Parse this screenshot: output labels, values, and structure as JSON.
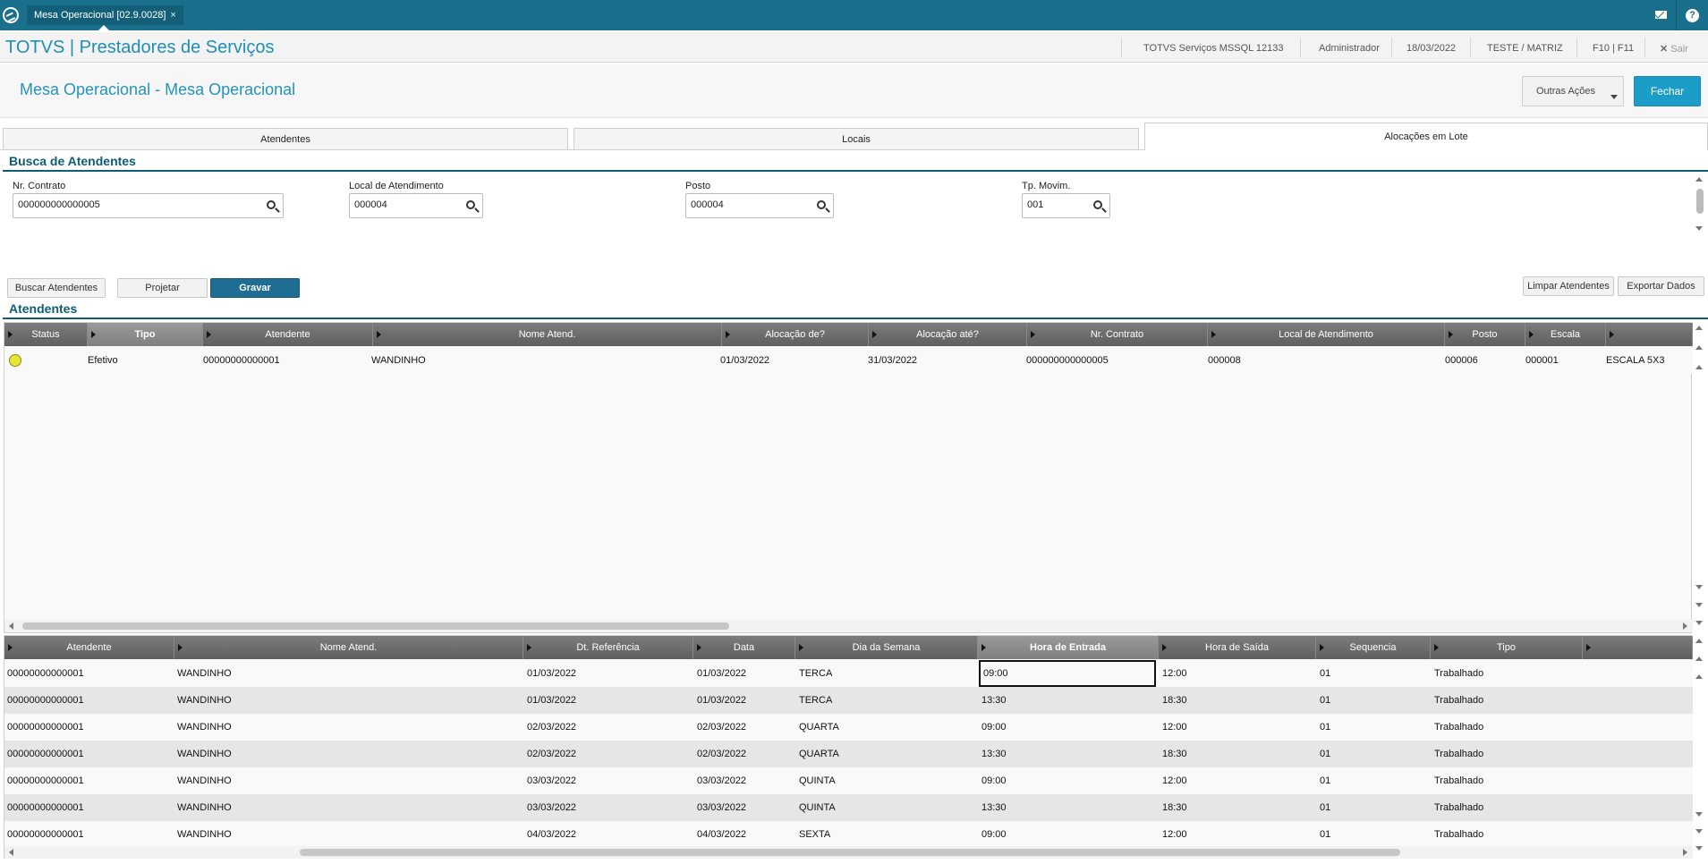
{
  "topbar": {
    "tab_label": "Mesa Operacional [02.9.0028]",
    "tab_close": "×",
    "help": "?"
  },
  "header": {
    "app_title": "TOTVS | Prestadores de Serviços",
    "environment": "TOTVS Serviços MSSQL 12133",
    "user": "Administrador",
    "date": "18/03/2022",
    "company": "TESTE / MATRIZ",
    "shortcuts": "F10 | F11",
    "exit_label": "Sair"
  },
  "page": {
    "title": "Mesa Operacional - Mesa Operacional",
    "btn_other": "Outras Ações",
    "btn_close": "Fechar"
  },
  "tabs": [
    {
      "label": "Atendentes"
    },
    {
      "label": "Locais"
    },
    {
      "label": "Alocações em Lote"
    }
  ],
  "search": {
    "section_title": "Busca de Atendentes",
    "fields": [
      {
        "label": "Nr. Contrato",
        "value": "000000000000005"
      },
      {
        "label": "Local de Atendimento",
        "value": "000004"
      },
      {
        "label": "Posto",
        "value": "000004"
      },
      {
        "label": "Tp. Movim.",
        "value": "001"
      }
    ],
    "btn_search": "Buscar Atendentes",
    "btn_project": "Projetar",
    "btn_save": "Gravar",
    "btn_clear": "Limpar Atendentes",
    "btn_export": "Exportar Dados"
  },
  "attendants": {
    "section_title": "Atendentes",
    "columns": [
      "Status",
      "Tipo",
      "Atendente",
      "Nome Atend.",
      "Alocação de?",
      "Alocação até?",
      "Nr. Contrato",
      "Local de Atendimento",
      "Posto",
      "Escala",
      ""
    ],
    "rows": [
      {
        "status": "yellow",
        "tipo": "Efetivo",
        "atendente": "00000000000001",
        "nome": "WANDINHO",
        "aloc_de": "01/03/2022",
        "aloc_ate": "31/03/2022",
        "contrato": "000000000000005",
        "local": "000008",
        "posto": "000006",
        "escala": "000001",
        "escala_desc": "ESCALA 5X3"
      }
    ]
  },
  "schedule": {
    "columns": [
      "Atendente",
      "Nome Atend.",
      "Dt. Referência",
      "Data",
      "Dia da Semana",
      "Hora de Entrada",
      "Hora de Saída",
      "Sequencia",
      "Tipo",
      ""
    ],
    "rows": [
      [
        "00000000000001",
        "WANDINHO",
        "01/03/2022",
        "01/03/2022",
        "TERCA",
        "09:00",
        "12:00",
        "01",
        "Trabalhado"
      ],
      [
        "00000000000001",
        "WANDINHO",
        "01/03/2022",
        "01/03/2022",
        "TERCA",
        "13:30",
        "18:30",
        "01",
        "Trabalhado"
      ],
      [
        "00000000000001",
        "WANDINHO",
        "02/03/2022",
        "02/03/2022",
        "QUARTA",
        "09:00",
        "12:00",
        "01",
        "Trabalhado"
      ],
      [
        "00000000000001",
        "WANDINHO",
        "02/03/2022",
        "02/03/2022",
        "QUARTA",
        "13:30",
        "18:30",
        "01",
        "Trabalhado"
      ],
      [
        "00000000000001",
        "WANDINHO",
        "03/03/2022",
        "03/03/2022",
        "QUINTA",
        "09:00",
        "12:00",
        "01",
        "Trabalhado"
      ],
      [
        "00000000000001",
        "WANDINHO",
        "03/03/2022",
        "03/03/2022",
        "QUINTA",
        "13:30",
        "18:30",
        "01",
        "Trabalhado"
      ],
      [
        "00000000000001",
        "WANDINHO",
        "04/03/2022",
        "04/03/2022",
        "SEXTA",
        "09:00",
        "12:00",
        "01",
        "Trabalhado"
      ]
    ]
  },
  "icons": {
    "logo": "totvs-logo-icon",
    "mail": "mail-icon",
    "help": "help-icon",
    "search": "search-icon",
    "close": "close-icon"
  },
  "colors": {
    "brand_bar": "#1a6f8c",
    "title_blue": "#2394bb",
    "primary_button": "#1f6d93",
    "close_button": "#1c9dc8",
    "status_yellow": "#e8e635"
  }
}
